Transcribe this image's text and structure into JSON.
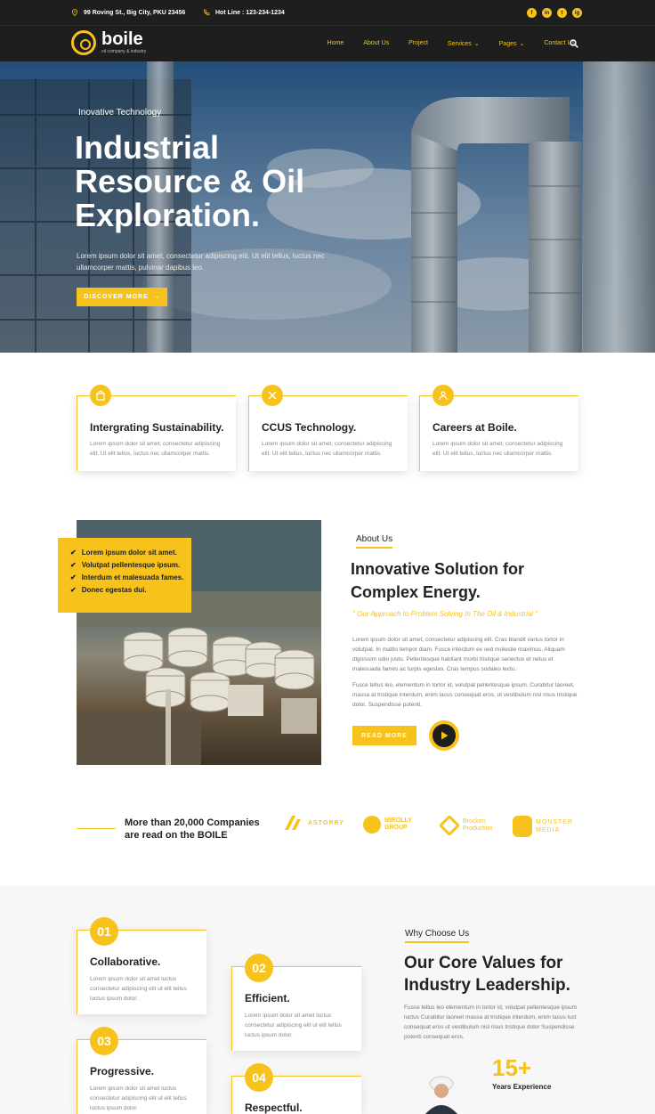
{
  "topbar": {
    "address": "99 Roving St., Big City, PKU 23456",
    "phone": "Hot Line : 123-234-1234",
    "socials": [
      "f",
      "in",
      "t",
      "ig"
    ]
  },
  "brand": {
    "name": "boile",
    "tagline": "oil company & industry"
  },
  "nav": {
    "items": [
      "Home",
      "About Us",
      "Project",
      "Services",
      "Pages",
      "Contact Us"
    ]
  },
  "hero": {
    "tag": "Inovative Technology",
    "title": "Industrial Resource & Oil Exploration.",
    "desc": "Lorem ipsum dolor sit amet, consectetur adipiscing elit. Ut elit tellus, luctus nec ullamcorper mattis, pulvinar dapibus leo.",
    "button": "DISCOVER MORE"
  },
  "features": [
    {
      "title": "Intergrating Sustainability.",
      "text": "Lorem ipsum dolor sit amet, consectetur adipiscing elit. Ut elit tellus, luctus nec ullamcorper mattis."
    },
    {
      "title": "CCUS Technology.",
      "text": "Lorem ipsum dolor sit amet, consectetur adipiscing elit. Ut elit tellus, luctus nec ullamcorper mattis."
    },
    {
      "title": "Careers at Boile.",
      "text": "Lorem ipsum dolor sit amet, consectetur adipiscing elit. Ut elit tellus, luctus nec ullamcorper mattis."
    }
  ],
  "about": {
    "checklist": [
      "Lorem ipsum dolor sit amet.",
      "Volutpat pellentesque ipsum.",
      "Interdum et malesuada fames.",
      "Donec egestas dui."
    ],
    "label": "About Us",
    "title": "Innovative Solution for Complex Energy.",
    "quote": "\" Our Approach to Problem Solving In The Oil & Industrial \"",
    "p1": "Lorem ipsum dolor sit amet, consectetur adipiscing elit. Cras blandit varius tortor in volutpat. In mattis tempor diam. Fusce interdum ex sed molestie maximus. Aliquam dignissim odio justo. Pellentesque habitant morbi tristique senectus et netus et malesuada fames ac turpis egestas. Cras tempus sodales lectu.",
    "p2": "Fusce tellus leo, elementum in tortor id, volutpat pellentesque ipsum. Curabitur laoreet, massa at tristique interdum, enim lacus consequat eros, ut vestibulum nisl risus tristique dolor. Suspendisse potenti.",
    "button": "READ MORE"
  },
  "partners": {
    "text": "More than 20,000 Companies are read on the BOILE",
    "logos": [
      "ASTORRY",
      "MIROLLY GROUP",
      "Brocken Production",
      "MONSTER MEDIA"
    ]
  },
  "values": {
    "label": "Why Choose Us",
    "title": "Our Core Values for Industry Leadership.",
    "desc": "Fusce tellus leo elementum in tortor id, volutpat pellentesque ipsum luctus Curabitur laoreet massa at tristique interdum, enim lacus luct consequat eros ut vestibulum nisl risus tristique dolor Suspendisse potenti consequat eros.",
    "years_number": "15+",
    "years_label": "Years Experience",
    "cards": [
      {
        "num": "01",
        "title": "Collaborative.",
        "text": "Lorem ipsum dolor sit amet luctus consectetur adipiscing elit ut elit tellus luctus ipsum dolor."
      },
      {
        "num": "02",
        "title": "Efficient.",
        "text": "Lorem ipsum dolor sit amet luctus consectetur adipiscing elit ut elit tellus luctus ipsum dolor."
      },
      {
        "num": "03",
        "title": "Progressive.",
        "text": "Lorem ipsum dolor sit amet luctus consectetur adipiscing elit ut elit tellus luctus ipsum dolor."
      },
      {
        "num": "04",
        "title": "Respectful.",
        "text": ""
      }
    ]
  },
  "colors": {
    "accent": "#f7c21b",
    "dark": "#1e1e1e"
  }
}
